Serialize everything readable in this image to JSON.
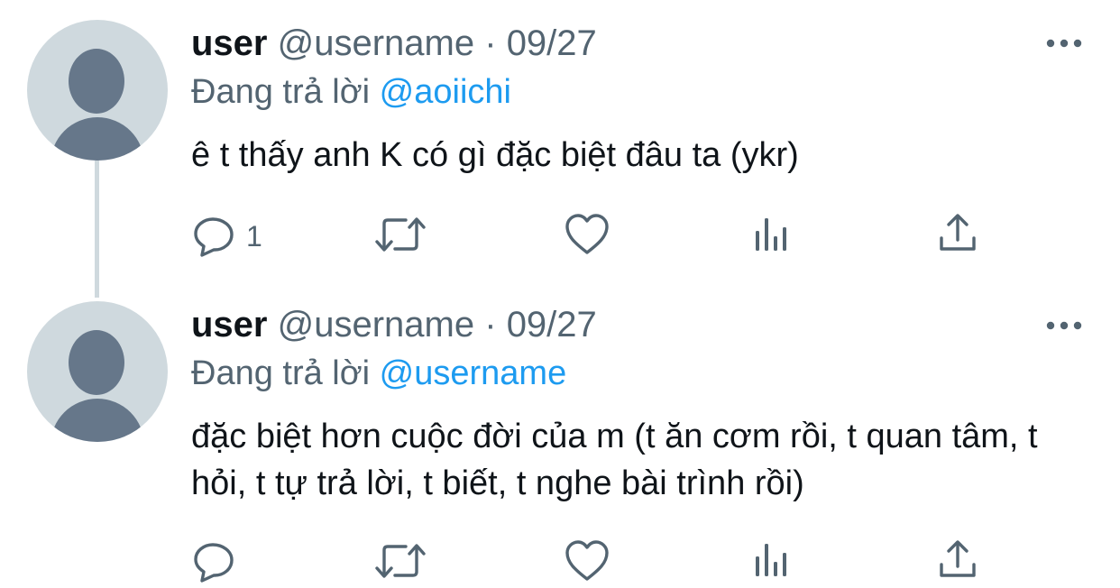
{
  "tweets": [
    {
      "name": "user",
      "handle": "@username",
      "separator": "·",
      "date": "09/27",
      "reply_prefix": "Đang trả lời",
      "reply_to": "@aoiichi",
      "text": "ê t thấy anh K có gì đặc biệt đâu ta (ykr)",
      "reply_count": "1"
    },
    {
      "name": "user",
      "handle": "@username",
      "separator": "·",
      "date": "09/27",
      "reply_prefix": "Đang trả lời",
      "reply_to": "@username",
      "text": "đặc biệt hơn cuộc đời của m (t ăn cơm rồi, t quan tâm, t hỏi, t tự trả lời, t biết, t nghe bài trình rồi)",
      "reply_count": ""
    }
  ],
  "icons": {
    "more": "more-horizontal-icon",
    "reply": "speech-bubble-icon",
    "retweet": "retweet-icon",
    "like": "heart-icon",
    "analytics": "bar-chart-icon",
    "share": "share-icon"
  },
  "colors": {
    "accent": "#1d9bf0",
    "secondary_text": "#536471",
    "primary_text": "#0f1419",
    "avatar_bg": "#cfd9de",
    "avatar_fg": "#66778a"
  }
}
